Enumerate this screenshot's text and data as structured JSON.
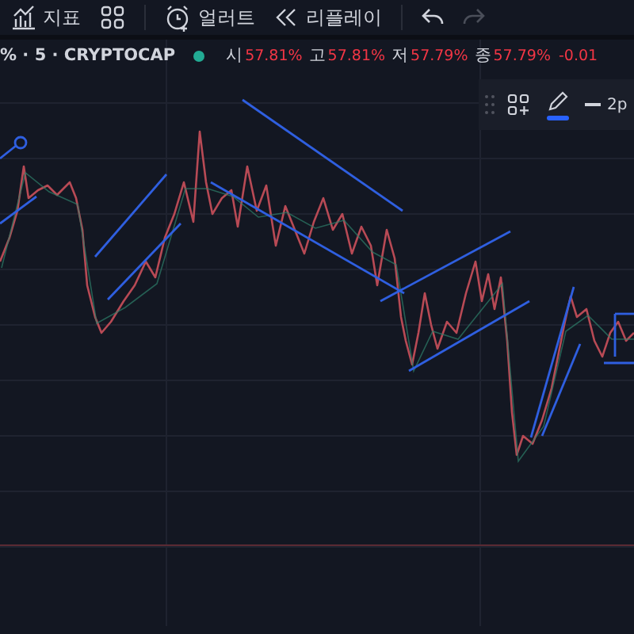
{
  "toolbar": [
    {
      "kind": "icon-label",
      "label": "지표"
    },
    {
      "kind": "icon"
    },
    {
      "kind": "divider"
    },
    {
      "kind": "icon-label",
      "label": "얼러트"
    },
    {
      "kind": "icon-label",
      "label": "리플레이"
    },
    {
      "kind": "divider"
    },
    {
      "kind": "icon",
      "disabled": false
    },
    {
      "kind": "icon",
      "disabled": true
    }
  ],
  "legend": {
    "symbol": "% · 5 · CRYPTOCAP",
    "ohlc": [
      {
        "label": "시",
        "value": "57.81%"
      },
      {
        "label": "고",
        "value": "57.81%"
      },
      {
        "label": "저",
        "value": "57.79%"
      },
      {
        "label": "종",
        "value": "57.79%"
      }
    ],
    "change": "-0.01"
  },
  "drawing_toolbar": {
    "pencil_selected": true,
    "line_width": "2p"
  }
}
